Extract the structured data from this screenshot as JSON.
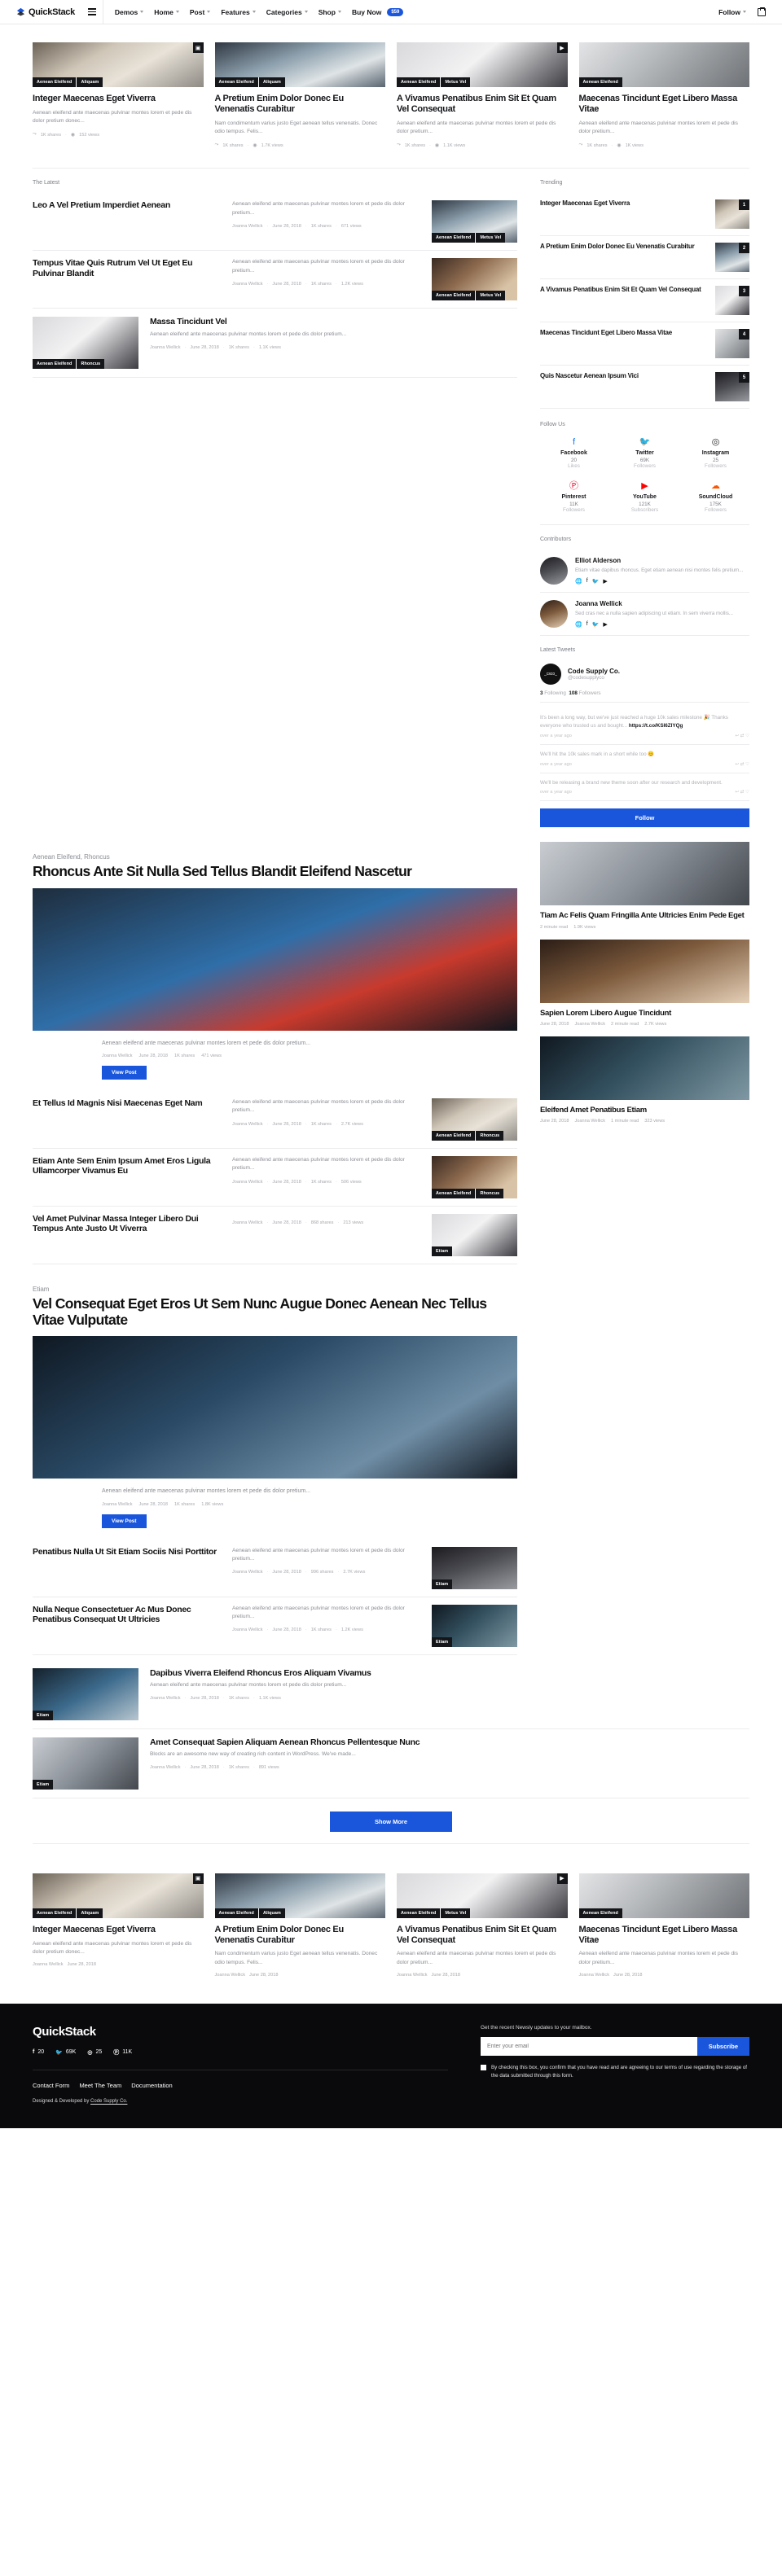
{
  "header": {
    "brand": "QuickStack",
    "nav": [
      {
        "label": "Demos",
        "caret": true
      },
      {
        "label": "Home",
        "caret": true
      },
      {
        "label": "Post",
        "caret": true
      },
      {
        "label": "Features",
        "caret": true
      },
      {
        "label": "Categories",
        "caret": true
      },
      {
        "label": "Shop",
        "caret": true
      },
      {
        "label": "Buy Now",
        "caret": false,
        "badge": "$59"
      }
    ],
    "follow_label": "Follow",
    "cart_icon": "cart-icon",
    "menu_icon": "hamburger-icon"
  },
  "top_cards": [
    {
      "cats": [
        "Aenean Eleifend",
        "Aliquam"
      ],
      "title": "Integer Maecenas Eget Viverra",
      "excerpt": "Aenean eleifend ante maecenas pulvinar montes lorem et pede dis dolor pretium donec...",
      "shares": "1K shares",
      "views": "152 views",
      "corner": "gallery-icon",
      "photo": "p1"
    },
    {
      "cats": [
        "Aenean Eleifend",
        "Aliquam"
      ],
      "title": "A Pretium Enim Dolor Donec Eu Venenatis Curabitur",
      "excerpt": "Nam condimentum varius justo Eget aenean tellus venenatis. Donec odio tempus. Felis...",
      "shares": "1K shares",
      "views": "1.7K views",
      "corner": "",
      "photo": "p2"
    },
    {
      "cats": [
        "Aenean Eleifend",
        "Metus Vel"
      ],
      "title": "A Vivamus Penatibus Enim Sit Et Quam Vel Consequat",
      "excerpt": "Aenean eleifend ante maecenas pulvinar montes lorem et pede dis dolor pretium...",
      "shares": "1K shares",
      "views": "1.1K views",
      "corner": "video-icon",
      "photo": "p3"
    },
    {
      "cats": [
        "Aenean Eleifend"
      ],
      "title": "Maecenas Tincidunt Eget Libero Massa Vitae",
      "excerpt": "Aenean eleifend ante maecenas pulvinar montes lorem et pede dis dolor pretium...",
      "shares": "1K shares",
      "views": "1K views",
      "corner": "",
      "photo": "p4"
    }
  ],
  "latest": {
    "label": "The Latest",
    "items": [
      {
        "title": "Leo A Vel Pretium Imperdiet Aenean",
        "excerpt": "Aenean eleifend ante maecenas pulvinar montes lorem et pede dis dolor pretium...",
        "author": "Joanna Wellick",
        "date": "June 28, 2018",
        "shares": "1K shares",
        "views": "671 views",
        "cats": [
          "Aenean Eleifend",
          "Metus Vel"
        ],
        "photo": "p2"
      },
      {
        "title": "Tempus Vitae Quis Rutrum Vel Ut Eget Eu Pulvinar Blandit",
        "excerpt": "Aenean eleifend ante maecenas pulvinar montes lorem et pede dis dolor pretium...",
        "author": "Joanna Wellick",
        "date": "June 28, 2018",
        "shares": "1K shares",
        "views": "1.2K views",
        "cats": [
          "Aenean Eleifend",
          "Metus Vel"
        ],
        "photo": "p7"
      }
    ],
    "wide": {
      "title": "Massa Tincidunt Vel",
      "excerpt": "Aenean eleifend ante maecenas pulvinar montes lorem et pede dis dolor pretium...",
      "author": "Joanna Wellick",
      "date": "June 28, 2018",
      "shares": "1.1K views",
      "views": "1.1K views",
      "shares2": "1K shares",
      "cats": [
        "Aenean Eleifend",
        "Rhoncus"
      ],
      "photo": "p3"
    }
  },
  "trending": {
    "label": "Trending",
    "items": [
      {
        "n": "1",
        "title": "Integer Maecenas Eget Viverra",
        "photo": "p1"
      },
      {
        "n": "2",
        "title": "A Pretium Enim Dolor Donec Eu Venenatis Curabitur",
        "photo": "p2"
      },
      {
        "n": "3",
        "title": "A Vivamus Penatibus Enim Sit Et Quam Vel Consequat",
        "photo": "p3"
      },
      {
        "n": "4",
        "title": "Maecenas Tincidunt Eget Libero Massa Vitae",
        "photo": "p4"
      },
      {
        "n": "5",
        "title": "Quis Nascetur Aenean Ipsum Vici",
        "photo": "p8"
      }
    ]
  },
  "follow_us": {
    "label": "Follow Us",
    "items": [
      {
        "icon": "facebook-icon",
        "glyph": "f",
        "color": "#1877F2",
        "name": "Facebook",
        "count": "20",
        "kind": "Likes"
      },
      {
        "icon": "twitter-icon",
        "glyph": "t",
        "color": "#1DA1F2",
        "name": "Twitter",
        "count": "69K",
        "kind": "Followers"
      },
      {
        "icon": "instagram-icon",
        "glyph": "i",
        "color": "#262626",
        "name": "Instagram",
        "count": "25",
        "kind": "Followers"
      },
      {
        "icon": "pinterest-icon",
        "glyph": "p",
        "color": "#E60023",
        "name": "Pinterest",
        "count": "11K",
        "kind": "Followers"
      },
      {
        "icon": "youtube-icon",
        "glyph": "y",
        "color": "#FF0000",
        "name": "YouTube",
        "count": "121K",
        "kind": "Subscribers"
      },
      {
        "icon": "soundcloud-icon",
        "glyph": "s",
        "color": "#FF5500",
        "name": "SoundCloud",
        "count": "175K",
        "kind": "Followers"
      }
    ]
  },
  "contributors": {
    "label": "Contributors",
    "items": [
      {
        "name": "Elliot Alderson",
        "bio": "Etiam vitae dapibus rhoncus. Eget etiam aenean nisi montes felis pretium...",
        "socials": [
          "globe-icon",
          "facebook-icon",
          "twitter-icon",
          "youtube-icon"
        ],
        "photo": "p8"
      },
      {
        "name": "Joanna Wellick",
        "bio": "Sed cras nec a nulla sapien adipiscing ut etiam. In sem viverra mollis...",
        "socials": [
          "globe-icon",
          "facebook-icon",
          "twitter-icon",
          "youtube-icon"
        ],
        "photo": "p11"
      }
    ]
  },
  "tweets": {
    "label": "Latest Tweets",
    "account_name": "Code Supply Co.",
    "handle": "@codesupplyco",
    "following": "3",
    "following_label": "Following",
    "followers": "108",
    "followers_label": "Followers",
    "avatar_text": "_csco_",
    "items": [
      {
        "text": "It's been a long way, but we've just reached a huge 10k sales milestone 🎉 Thanks everyone who trusted us and bought... ",
        "link": "https://t.co/KSI6ZIYQg",
        "time": "over a year ago"
      },
      {
        "text": "We'll hit the 10k sales mark in a short while too 😊",
        "link": "",
        "time": "over a year ago"
      },
      {
        "text": "We'll be releasing a brand new theme soon after our research and development.",
        "link": "",
        "time": "over a year ago"
      }
    ],
    "follow_button": "Follow"
  },
  "feature1": {
    "cat": "Aenean Eleifend, Rhoncus",
    "title": "Rhoncus Ante Sit Nulla Sed Tellus Blandit Eleifend Nascetur",
    "excerpt": "Aenean eleifend ante maecenas pulvinar montes lorem et pede dis dolor pretium...",
    "author": "Joanna Wellick",
    "date": "June 28, 2018",
    "shares": "1K shares",
    "views": "471 views",
    "button": "View Post",
    "photo": "p5"
  },
  "mid_items": [
    {
      "title": "Et Tellus Id Magnis Nisi Maecenas Eget Nam",
      "excerpt": "Aenean eleifend ante maecenas pulvinar montes lorem et pede dis dolor pretium...",
      "author": "Joanna Wellick",
      "date": "June 28, 2018",
      "shares": "1K shares",
      "views": "2.7K views",
      "cats": [
        "Aenean Eleifend",
        "Rhoncus"
      ],
      "photo": "p1"
    },
    {
      "title": "Etiam Ante Sem Enim Ipsum Amet Eros Ligula Ullamcorper Vivamus Eu",
      "excerpt": "Aenean eleifend ante maecenas pulvinar montes lorem et pede dis dolor pretium...",
      "author": "Joanna Wellick",
      "date": "June 28, 2018",
      "shares": "1K shares",
      "views": "506 views",
      "cats": [
        "Aenean Eleifend",
        "Rhoncus"
      ],
      "photo": "p7"
    },
    {
      "title": "Vel Amet Pulvinar Massa Integer Libero Dui Tempus Ante Justo Ut Viverra",
      "excerpt": "",
      "author": "Joanna Wellick",
      "date": "June 28, 2018",
      "shares": "868 shares",
      "views": "213 views",
      "cats": [
        "Etiam"
      ],
      "photo": "p3"
    }
  ],
  "feature2": {
    "cat": "Etiam",
    "title": "Vel Consequat Eget Eros Ut Sem Nunc Augue Donec Aenean Nec Tellus Vitae Vulputate",
    "excerpt": "Aenean eleifend ante maecenas pulvinar montes lorem et pede dis dolor pretium...",
    "author": "Joanna Wellick",
    "date": "June 28, 2018",
    "shares": "1K shares",
    "views": "1.8K views",
    "button": "View Post",
    "photo": "p6"
  },
  "lower_items": [
    {
      "title": "Penatibus Nulla Ut Sit Etiam Sociis Nisi Porttitor",
      "excerpt": "Aenean eleifend ante maecenas pulvinar montes lorem et pede dis dolor pretium...",
      "author": "Joanna Wellick",
      "date": "June 28, 2018",
      "shares": "996 shares",
      "views": "2.7K views",
      "cats": [
        "Etiam"
      ],
      "photo": "p8"
    },
    {
      "title": "Nulla Neque Consectetuer Ac Mus Donec Penatibus Consequat Ut Ultricies",
      "excerpt": "Aenean eleifend ante maecenas pulvinar montes lorem et pede dis dolor pretium...",
      "author": "Joanna Wellick",
      "date": "June 28, 2018",
      "shares": "1K shares",
      "views": "1.2K views",
      "cats": [
        "Etiam"
      ],
      "photo": "p12"
    }
  ],
  "wide_items": [
    {
      "title": "Dapibus Viverra Eleifend Rhoncus Eros Aliquam Vivamus",
      "excerpt": "Aenean eleifend ante maecenas pulvinar montes lorem et pede dis dolor pretium...",
      "author": "Joanna Wellick",
      "date": "June 28, 2018",
      "shares": "1K shares",
      "views": "1.1K views",
      "cats": [
        "Etiam"
      ],
      "photo": "p9"
    },
    {
      "title": "Amet Consequat Sapien Aliquam Aenean Rhoncus Pellentesque Nunc",
      "excerpt": "Blocks are an awesome new way of creating rich content in WordPress. We've made...",
      "author": "Joanna Wellick",
      "date": "June 28, 2018",
      "shares": "1K shares",
      "views": "891 views",
      "cats": [
        "Etiam"
      ],
      "photo": "p10"
    }
  ],
  "side_cards": [
    {
      "title": "Tiam Ac Felis Quam Fringilla Ante Ultricies Enim Pede Eget",
      "date": "",
      "read": "2 minute read",
      "views": "1.9K views",
      "photo": "p10"
    },
    {
      "title": "Sapien Lorem Libero Augue Tincidunt",
      "date": "June 28, 2018",
      "author": "Joanna Wellick",
      "read": "2 minute read",
      "views": "2.7K views",
      "photo": "p11"
    },
    {
      "title": "Eleifend Amet Penatibus Etiam",
      "date": "June 28, 2018",
      "author": "Joanna Wellick",
      "read": "1 minute read",
      "views": "323 views",
      "photo": "p12"
    }
  ],
  "show_more": "Show More",
  "bottom_cards": [
    {
      "cats": [
        "Aenean Eleifend",
        "Aliquam"
      ],
      "title": "Integer Maecenas Eget Viverra",
      "excerpt": "Aenean eleifend ante maecenas pulvinar montes lorem et pede dis dolor pretium donec...",
      "author": "Joanna Wellick",
      "date": "June 28, 2018",
      "corner": "gallery-icon",
      "photo": "p1"
    },
    {
      "cats": [
        "Aenean Eleifend",
        "Aliquam"
      ],
      "title": "A Pretium Enim Dolor Donec Eu Venenatis Curabitur",
      "excerpt": "Nam condimentum varius justo Eget aenean tellus venenatis. Donec odio tempus. Felis...",
      "author": "Joanna Wellick",
      "date": "June 28, 2018",
      "corner": "",
      "photo": "p2"
    },
    {
      "cats": [
        "Aenean Eleifend",
        "Metus Vel"
      ],
      "title": "A Vivamus Penatibus Enim Sit Et Quam Vel Consequat",
      "excerpt": "Aenean eleifend ante maecenas pulvinar montes lorem et pede dis dolor pretium...",
      "author": "Joanna Wellick",
      "date": "June 28, 2018",
      "corner": "video-icon",
      "photo": "p3"
    },
    {
      "cats": [
        "Aenean Eleifend"
      ],
      "title": "Maecenas Tincidunt Eget Libero Massa Vitae",
      "excerpt": "Aenean eleifend ante maecenas pulvinar montes lorem et pede dis dolor pretium...",
      "author": "Joanna Wellick",
      "date": "June 28, 2018",
      "corner": "",
      "photo": "p4"
    }
  ],
  "footer": {
    "brand": "QuickStack",
    "socials": [
      {
        "icon": "facebook-icon",
        "glyph": "f",
        "count": "20"
      },
      {
        "icon": "twitter-icon",
        "glyph": "t",
        "count": "69K"
      },
      {
        "icon": "instagram-icon",
        "glyph": "i",
        "count": "25"
      },
      {
        "icon": "pinterest-icon",
        "glyph": "p",
        "count": "11K"
      }
    ],
    "links": [
      "Contact Form",
      "Meet The Team",
      "Documentation"
    ],
    "credit_prefix": "Designed & Developed by ",
    "credit_link": "Code Supply Co.",
    "newsletter_label": "Get the recent Newsly updates to your mailbox.",
    "email_placeholder": "Enter your email",
    "subscribe": "Subscribe",
    "terms": "By checking this box, you confirm that you have read and are agreeing to our terms of use regarding the storage of the data submitted through this form."
  },
  "colors": {
    "accent": "#1a56db",
    "dark": "#0a0a0c",
    "muted": "#8b8d94"
  }
}
